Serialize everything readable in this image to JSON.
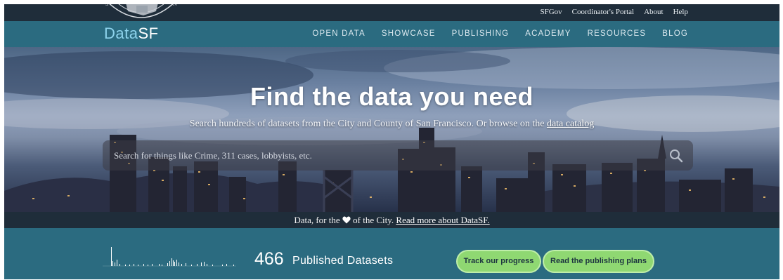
{
  "utility_nav": {
    "links": [
      "SFGov",
      "Coordinator's Portal",
      "About",
      "Help"
    ]
  },
  "brand": {
    "part1": "Data",
    "part2": "SF"
  },
  "main_nav": {
    "links": [
      "OPEN DATA",
      "SHOWCASE",
      "PUBLISHING",
      "ACADEMY",
      "RESOURCES",
      "BLOG"
    ]
  },
  "hero": {
    "title": "Find the data you need",
    "subtitle_prefix": "Search hundreds of datasets from the City and County of San Francisco. Or browse on the ",
    "subtitle_link": "data catalog",
    "search_placeholder": "Search for things like Crime, 311 cases, lobbyists, etc."
  },
  "tagline": {
    "prefix": "Data, for the",
    "suffix": "of the City.",
    "link": "Read more about DataSF."
  },
  "stats": {
    "count": "466",
    "label": "Published Datasets",
    "buttons": {
      "track": "Track our progress",
      "plans": "Read the publishing plans"
    }
  },
  "icons": {
    "search": "search-icon",
    "heart": "heart-icon",
    "seal": "city-seal-logo"
  },
  "colors": {
    "util_bar": "#1f2d3a",
    "nav_bar": "#2b6b80",
    "brand_accent": "#8ed3ec",
    "button_green": "#8fd872"
  }
}
